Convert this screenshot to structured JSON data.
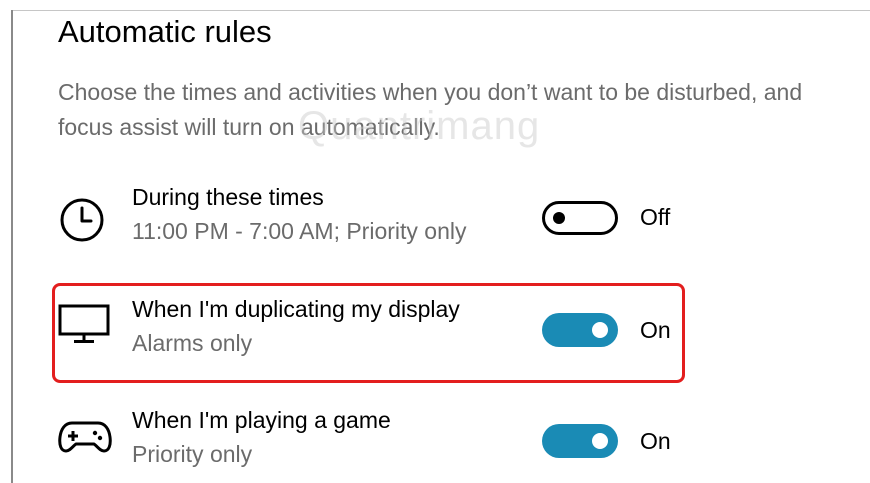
{
  "section": {
    "title": "Automatic rules",
    "description": "Choose the times and activities when you don’t want to be disturbed, and focus assist will turn on automatically."
  },
  "watermark": "Quantrimang",
  "rules": [
    {
      "icon": "clock-icon",
      "title": "During these times",
      "subtitle": "11:00 PM - 7:00 AM; Priority only",
      "state": "Off",
      "enabled": false
    },
    {
      "icon": "monitor-icon",
      "title": "When I'm duplicating my display",
      "subtitle": "Alarms only",
      "state": "On",
      "enabled": true
    },
    {
      "icon": "gamepad-icon",
      "title": "When I'm playing a game",
      "subtitle": "Priority only",
      "state": "On",
      "enabled": true
    }
  ],
  "colors": {
    "toggle_on": "#1a8bb5",
    "highlight": "#e31e1e",
    "secondary_text": "#6b6b6b"
  }
}
